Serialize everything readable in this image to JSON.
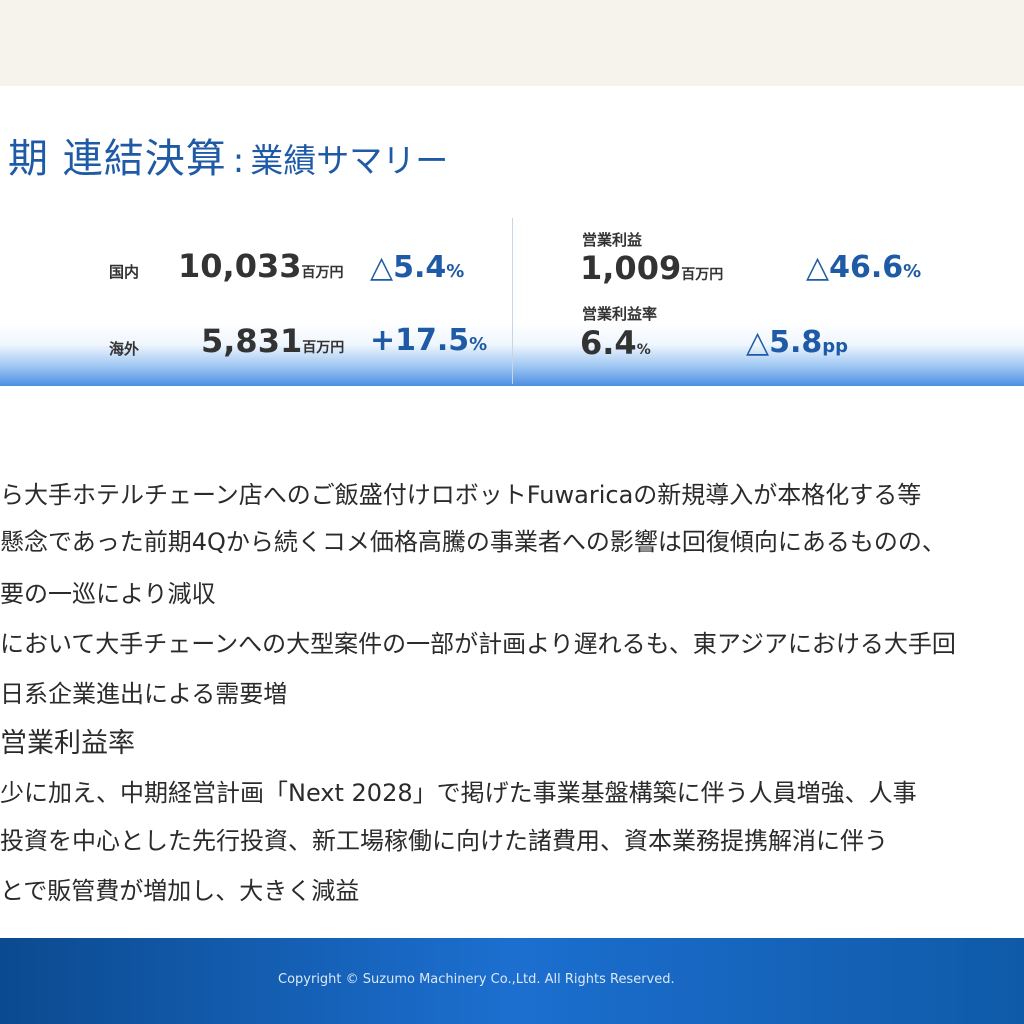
{
  "title": {
    "main": "期 連結決算",
    "separator": ":",
    "sub": "業績サマリー"
  },
  "summary": {
    "domestic": {
      "label": "国内",
      "value": "10,033",
      "unit": "百万円",
      "change": "△5.4",
      "change_unit": "%"
    },
    "overseas": {
      "label": "海外",
      "value": "5,831",
      "unit": "百万円",
      "change": "+17.5",
      "change_unit": "%"
    },
    "operating_profit": {
      "label": "営業利益",
      "value": "1,009",
      "unit": "百万円",
      "change": "△46.6",
      "change_unit": "%"
    },
    "operating_margin": {
      "label": "営業利益率",
      "value": "6.4",
      "unit": "%",
      "change": "△5.8",
      "change_unit": "pp"
    }
  },
  "body": {
    "lines": [
      "ら大手ホテルチェーン店へのご飯盛付けロボットFuwaricaの新規導入が本格化する等",
      "懸念であった前期4Qから続くコメ価格高騰の事業者への影響は回復傾向にあるものの、",
      "要の一巡により減収",
      "において大手チェーンへの大型案件の一部が計画より遅れるも、東アジアにおける大手回",
      "日系企業進出による需要増",
      "営業利益率",
      "少に加え、中期経営計画「Next 2028」で掲げた事業基盤構築に伴う人員増強、人事",
      "投資を中心とした先行投資、新工場稼働に向けた諸費用、資本業務提携解消に伴う",
      "とで販管費が増加し、大きく減益"
    ]
  },
  "footer": {
    "copyright": "Copyright © Suzumo Machinery Co.,Ltd. All Rights Reserved."
  }
}
